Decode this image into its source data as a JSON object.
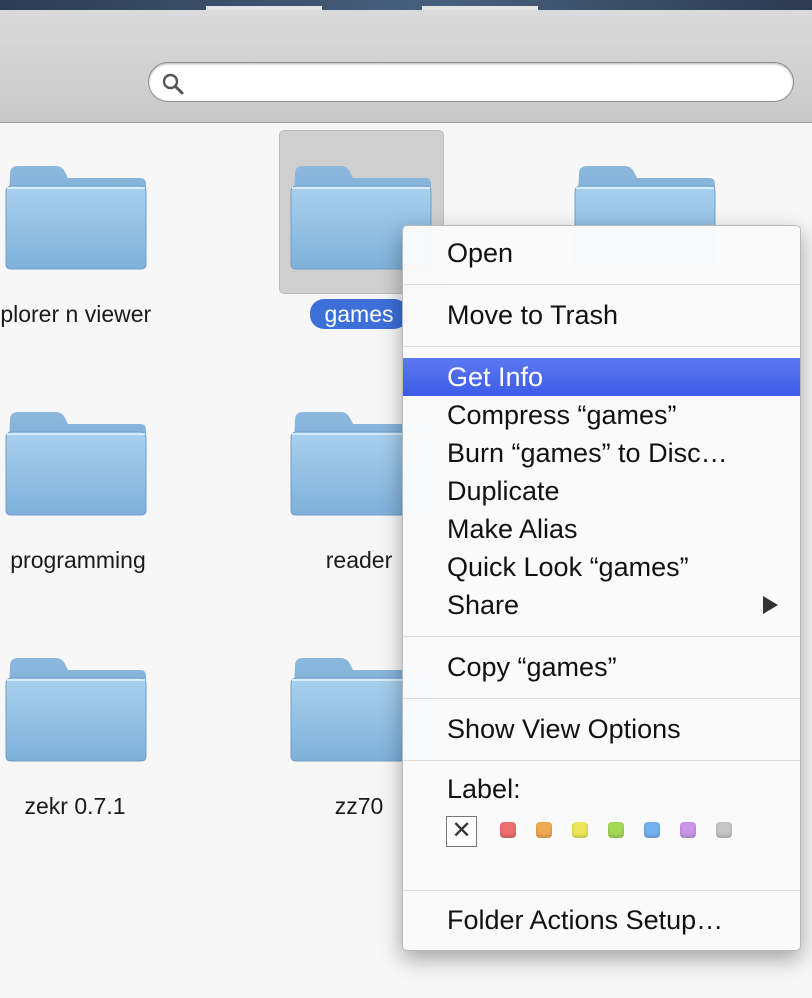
{
  "search": {
    "value": "",
    "placeholder": ""
  },
  "items": [
    {
      "label": "xplorer n viewer",
      "selected": false
    },
    {
      "label": "games",
      "selected": true
    },
    {
      "label": "",
      "selected": false
    },
    {
      "label": "programming",
      "selected": false
    },
    {
      "label": "reader",
      "selected": false
    },
    {
      "label": "zekr 0.7.1",
      "selected": false
    },
    {
      "label": "zz70",
      "selected": false
    }
  ],
  "context_menu": {
    "open": "Open",
    "move_to_trash": "Move to Trash",
    "get_info": "Get Info",
    "compress": "Compress “games”",
    "burn": "Burn “games” to Disc…",
    "duplicate": "Duplicate",
    "make_alias": "Make Alias",
    "quick_look": "Quick Look “games”",
    "share": "Share",
    "copy": "Copy “games”",
    "show_view_options": "Show View Options",
    "label_heading": "Label:",
    "no_label_glyph": "✕",
    "label_colors": [
      "#ec6e6e",
      "#f0aa52",
      "#ece85a",
      "#a6d957",
      "#74b1f0",
      "#c897e6",
      "#c6c6c6"
    ],
    "folder_actions_setup": "Folder Actions Setup…"
  },
  "colors": {
    "highlight": "#3d5ce6",
    "selection": "#3d6fd8",
    "folder": "#8fbde3"
  },
  "icons": {
    "search": "magnifier-icon",
    "folder": "folder-icon",
    "submenu": "chevron-right-icon"
  }
}
